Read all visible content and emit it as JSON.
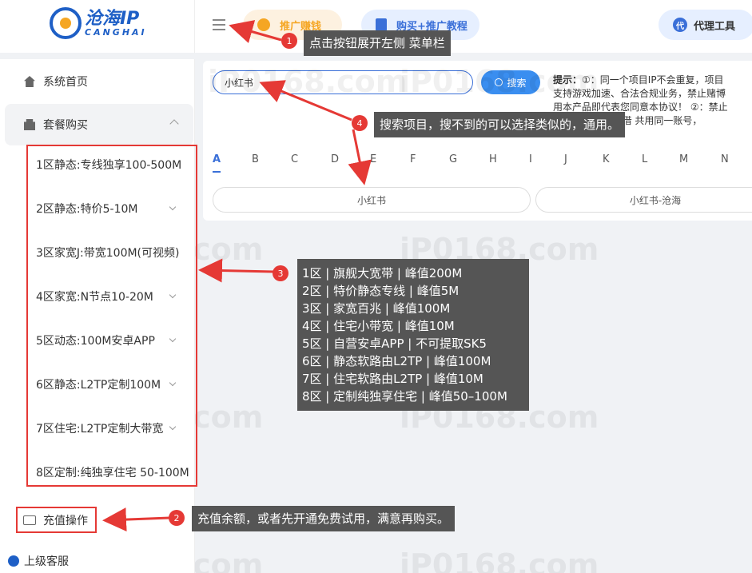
{
  "brand": {
    "name": "沧海IP",
    "sub": "CANGHAI"
  },
  "sidebar": {
    "home": "系统首页",
    "package": "套餐购买",
    "packages": [
      "1区静态:专线独享100-500M",
      "2区静态:特价5-10M",
      "3区家宽J:带宽100M(可视频)",
      "4区家宽:N节点10-20M",
      "5区动态:100M安卓APP",
      "6区静态:L2TP定制100M",
      "7区住宅:L2TP定制大带宽",
      "8区定制:纯独享住宅 50-100M"
    ],
    "recharge": "充值操作",
    "support": "上级客服"
  },
  "topbar": {
    "promo": "推广赚钱",
    "tutorial": "购买+推广教程",
    "agent": "代理工具",
    "agent_icon_text": "代"
  },
  "search": {
    "value": "小红书",
    "button": "搜索",
    "tip_label": "提示：",
    "tip_lines": [
      "①：同一个项目IP不会重复，项目",
      "支持游戏加速、合法合规业务，禁止赌博",
      "用本产品即代表您同意本协议！ ②：禁止",
      "③：请勿出租 出借 共用同一账号，"
    ]
  },
  "letters": [
    "A",
    "B",
    "C",
    "D",
    "E",
    "F",
    "G",
    "H",
    "I",
    "J",
    "K",
    "L",
    "M",
    "N"
  ],
  "results": [
    "小红书",
    "小红书-沧海"
  ],
  "watermark": "iP0168.com",
  "annotations": {
    "a1": {
      "num": "1",
      "text": "点击按钮展开左侧 菜单栏"
    },
    "a2": {
      "num": "2",
      "text": "充值余额，或者先开通免费试用，满意再购买。"
    },
    "a3": {
      "num": "3",
      "lines": [
        "1区 | 旗舰大宽带 | 峰值200M",
        "2区 | 特价静态专线 | 峰值5M",
        "3区 | 家宽百兆 | 峰值100M",
        "4区 | 住宅小带宽 | 峰值10M",
        "5区 | 自营安卓APP | 不可提取SK5",
        "6区 | 静态软路由L2TP | 峰值100M",
        "7区 | 住宅软路由L2TP | 峰值10M",
        "8区 | 定制纯独享住宅 | 峰值50–100M"
      ]
    },
    "a4": {
      "num": "4",
      "text": "搜索项目，搜不到的可以选择类似的，通用。"
    }
  },
  "colors": {
    "accent": "#3a6fd8",
    "annotation_red": "#e53935",
    "callout_bg": "#555555"
  }
}
